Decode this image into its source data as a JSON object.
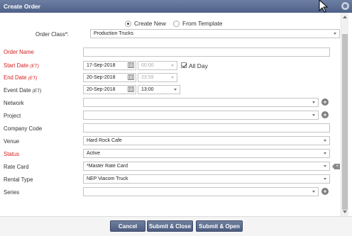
{
  "window": {
    "title": "Create Order"
  },
  "mode": {
    "create_new": "Create New",
    "from_template": "From Template"
  },
  "order_class": {
    "label": "Order Class*:",
    "value": "Production Trucks"
  },
  "fields": {
    "order_name": {
      "label": "Order Name",
      "value": ""
    },
    "start_date": {
      "label": "Start Date",
      "tz": "(ET)",
      "date": "17-Sep-2018",
      "time": "00:00",
      "all_day": "All Day"
    },
    "end_date": {
      "label": "End Date",
      "tz": "(ET)",
      "date": "20-Sep-2018",
      "time": "23:59"
    },
    "event_date": {
      "label": "Event Date",
      "tz": "(ET)",
      "date": "20-Sep-2018",
      "time": "13:00"
    },
    "network": {
      "label": "Network",
      "value": ""
    },
    "project": {
      "label": "Project",
      "value": ""
    },
    "company_code": {
      "label": "Company Code",
      "value": ""
    },
    "venue": {
      "label": "Venue",
      "value": "Hard Rock Cafe"
    },
    "status": {
      "label": "Status",
      "value": "Active"
    },
    "rate_card": {
      "label": "Rate Card",
      "value": "*Master Rate Card"
    },
    "rental_type": {
      "label": "Rental Type",
      "value": "NEP Viacom Truck"
    },
    "series": {
      "label": "Series",
      "value": ""
    }
  },
  "buttons": {
    "cancel": "Cancel",
    "submit_close": "Submit & Close",
    "submit_open": "Submit & Open"
  },
  "colors": {
    "titlebar": "#5a6b93",
    "required": "#d62020",
    "button": "#5d6d8f"
  }
}
